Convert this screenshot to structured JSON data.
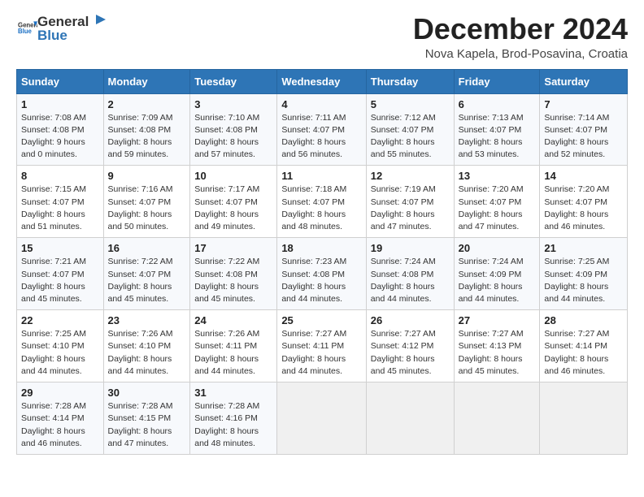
{
  "header": {
    "logo_general": "General",
    "logo_blue": "Blue",
    "main_title": "December 2024",
    "subtitle": "Nova Kapela, Brod-Posavina, Croatia"
  },
  "calendar": {
    "weekdays": [
      "Sunday",
      "Monday",
      "Tuesday",
      "Wednesday",
      "Thursday",
      "Friday",
      "Saturday"
    ],
    "weeks": [
      [
        {
          "day": "1",
          "sunrise": "7:08 AM",
          "sunset": "4:08 PM",
          "daylight": "9 hours and 0 minutes."
        },
        {
          "day": "2",
          "sunrise": "7:09 AM",
          "sunset": "4:08 PM",
          "daylight": "8 hours and 59 minutes."
        },
        {
          "day": "3",
          "sunrise": "7:10 AM",
          "sunset": "4:08 PM",
          "daylight": "8 hours and 57 minutes."
        },
        {
          "day": "4",
          "sunrise": "7:11 AM",
          "sunset": "4:07 PM",
          "daylight": "8 hours and 56 minutes."
        },
        {
          "day": "5",
          "sunrise": "7:12 AM",
          "sunset": "4:07 PM",
          "daylight": "8 hours and 55 minutes."
        },
        {
          "day": "6",
          "sunrise": "7:13 AM",
          "sunset": "4:07 PM",
          "daylight": "8 hours and 53 minutes."
        },
        {
          "day": "7",
          "sunrise": "7:14 AM",
          "sunset": "4:07 PM",
          "daylight": "8 hours and 52 minutes."
        }
      ],
      [
        {
          "day": "8",
          "sunrise": "7:15 AM",
          "sunset": "4:07 PM",
          "daylight": "8 hours and 51 minutes."
        },
        {
          "day": "9",
          "sunrise": "7:16 AM",
          "sunset": "4:07 PM",
          "daylight": "8 hours and 50 minutes."
        },
        {
          "day": "10",
          "sunrise": "7:17 AM",
          "sunset": "4:07 PM",
          "daylight": "8 hours and 49 minutes."
        },
        {
          "day": "11",
          "sunrise": "7:18 AM",
          "sunset": "4:07 PM",
          "daylight": "8 hours and 48 minutes."
        },
        {
          "day": "12",
          "sunrise": "7:19 AM",
          "sunset": "4:07 PM",
          "daylight": "8 hours and 47 minutes."
        },
        {
          "day": "13",
          "sunrise": "7:20 AM",
          "sunset": "4:07 PM",
          "daylight": "8 hours and 47 minutes."
        },
        {
          "day": "14",
          "sunrise": "7:20 AM",
          "sunset": "4:07 PM",
          "daylight": "8 hours and 46 minutes."
        }
      ],
      [
        {
          "day": "15",
          "sunrise": "7:21 AM",
          "sunset": "4:07 PM",
          "daylight": "8 hours and 45 minutes."
        },
        {
          "day": "16",
          "sunrise": "7:22 AM",
          "sunset": "4:07 PM",
          "daylight": "8 hours and 45 minutes."
        },
        {
          "day": "17",
          "sunrise": "7:22 AM",
          "sunset": "4:08 PM",
          "daylight": "8 hours and 45 minutes."
        },
        {
          "day": "18",
          "sunrise": "7:23 AM",
          "sunset": "4:08 PM",
          "daylight": "8 hours and 44 minutes."
        },
        {
          "day": "19",
          "sunrise": "7:24 AM",
          "sunset": "4:08 PM",
          "daylight": "8 hours and 44 minutes."
        },
        {
          "day": "20",
          "sunrise": "7:24 AM",
          "sunset": "4:09 PM",
          "daylight": "8 hours and 44 minutes."
        },
        {
          "day": "21",
          "sunrise": "7:25 AM",
          "sunset": "4:09 PM",
          "daylight": "8 hours and 44 minutes."
        }
      ],
      [
        {
          "day": "22",
          "sunrise": "7:25 AM",
          "sunset": "4:10 PM",
          "daylight": "8 hours and 44 minutes."
        },
        {
          "day": "23",
          "sunrise": "7:26 AM",
          "sunset": "4:10 PM",
          "daylight": "8 hours and 44 minutes."
        },
        {
          "day": "24",
          "sunrise": "7:26 AM",
          "sunset": "4:11 PM",
          "daylight": "8 hours and 44 minutes."
        },
        {
          "day": "25",
          "sunrise": "7:27 AM",
          "sunset": "4:11 PM",
          "daylight": "8 hours and 44 minutes."
        },
        {
          "day": "26",
          "sunrise": "7:27 AM",
          "sunset": "4:12 PM",
          "daylight": "8 hours and 45 minutes."
        },
        {
          "day": "27",
          "sunrise": "7:27 AM",
          "sunset": "4:13 PM",
          "daylight": "8 hours and 45 minutes."
        },
        {
          "day": "28",
          "sunrise": "7:27 AM",
          "sunset": "4:14 PM",
          "daylight": "8 hours and 46 minutes."
        }
      ],
      [
        {
          "day": "29",
          "sunrise": "7:28 AM",
          "sunset": "4:14 PM",
          "daylight": "8 hours and 46 minutes."
        },
        {
          "day": "30",
          "sunrise": "7:28 AM",
          "sunset": "4:15 PM",
          "daylight": "8 hours and 47 minutes."
        },
        {
          "day": "31",
          "sunrise": "7:28 AM",
          "sunset": "4:16 PM",
          "daylight": "8 hours and 48 minutes."
        },
        null,
        null,
        null,
        null
      ]
    ]
  }
}
